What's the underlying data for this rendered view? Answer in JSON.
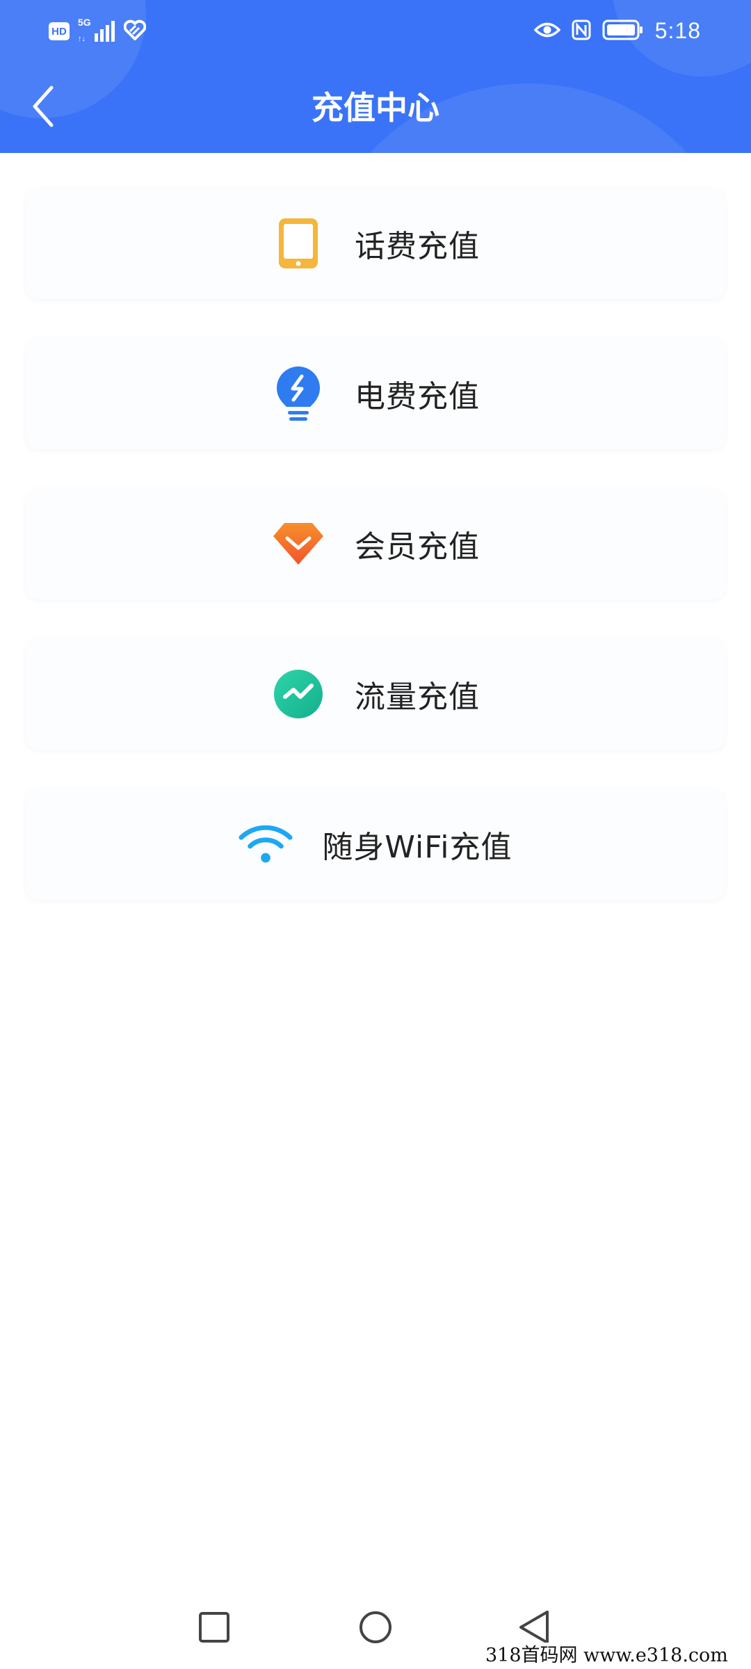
{
  "status_bar": {
    "left_badge": "HD",
    "network": "5G",
    "time": "5:18"
  },
  "header": {
    "title": "充值中心"
  },
  "menu": {
    "items": [
      {
        "label": "话费充值",
        "icon": "phone-icon",
        "color": "#f4b63b"
      },
      {
        "label": "电费充值",
        "icon": "lightbulb-icon",
        "color": "#2f7bf0"
      },
      {
        "label": "会员充值",
        "icon": "diamond-icon",
        "color": "#f36f2a"
      },
      {
        "label": "流量充值",
        "icon": "trend-icon",
        "color": "#1cc49c"
      },
      {
        "label": "随身WiFi充值",
        "icon": "wifi-icon",
        "color": "#1ea7f4"
      }
    ]
  },
  "watermark": {
    "text": "318首码网  www.e318.com"
  },
  "colors": {
    "header_bg": "#3a73f7",
    "item_bg": "#fcfdff",
    "text": "#222222"
  }
}
